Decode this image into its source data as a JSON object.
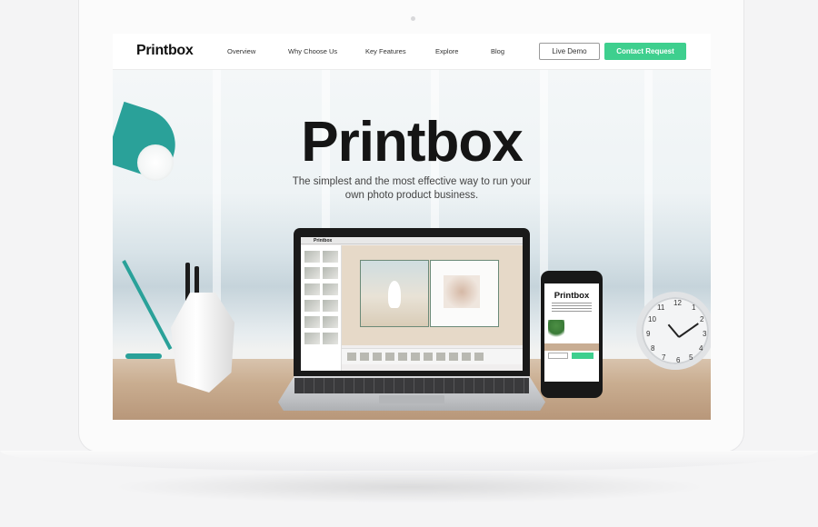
{
  "nav": {
    "logo": "Printbox",
    "links": [
      "Overview",
      "Why Choose Us",
      "Key Features",
      "Explore",
      "Blog"
    ],
    "live_demo": "Live Demo",
    "contact": "Contact Request"
  },
  "hero": {
    "title": "Printbox",
    "subtitle": "The simplest and the most effective way to run your own photo product business."
  },
  "mockups": {
    "app_logo": "Printbox",
    "phone_logo": "Printbox"
  },
  "colors": {
    "accent": "#3ecf8e",
    "lamp": "#2aa199"
  },
  "clock": {
    "numerals": [
      "12",
      "1",
      "2",
      "3",
      "4",
      "5",
      "6",
      "7",
      "8",
      "9",
      "10",
      "11"
    ]
  }
}
